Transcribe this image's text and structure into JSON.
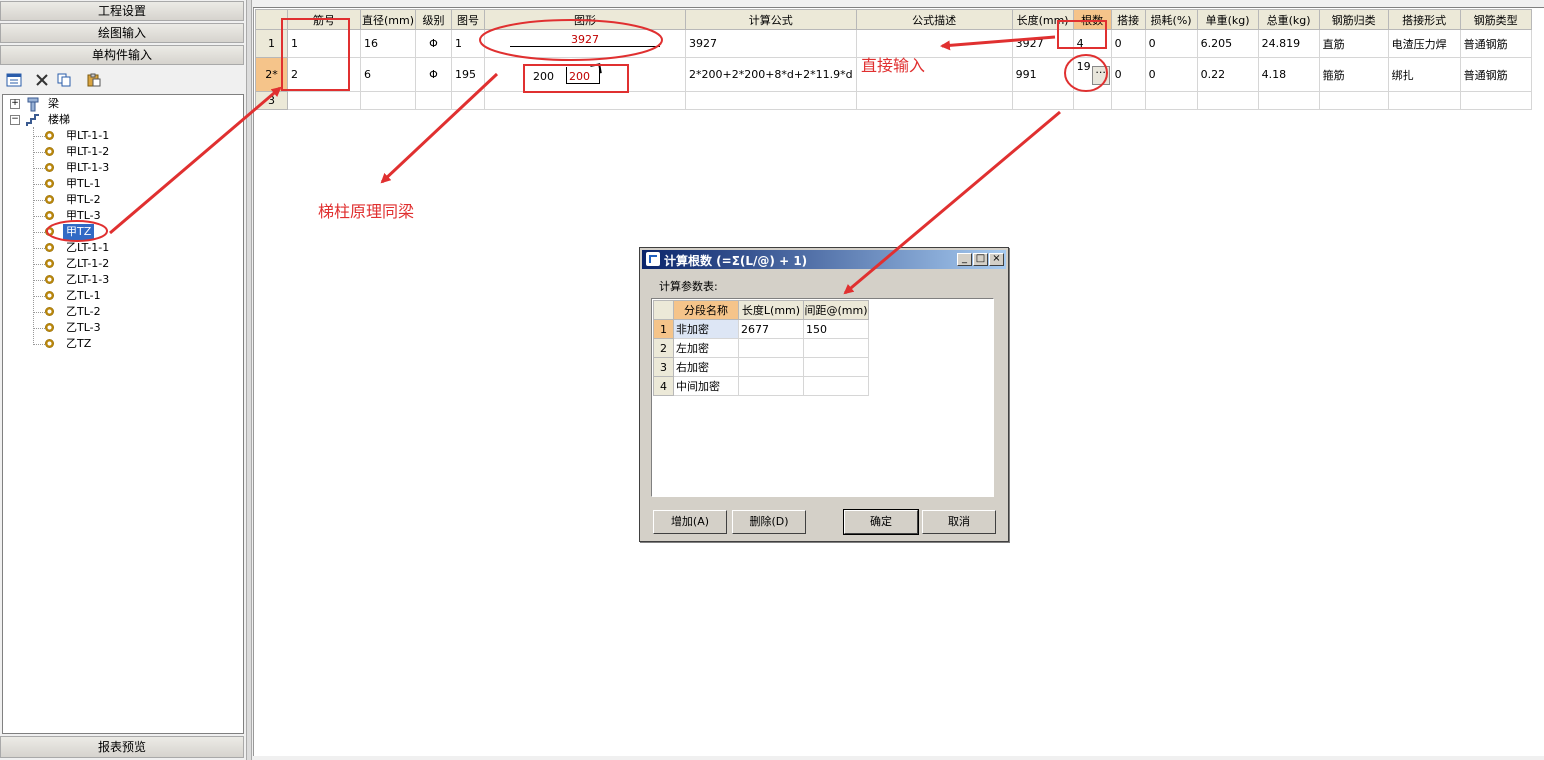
{
  "left_panel": {
    "nav": [
      "工程设置",
      "绘图输入",
      "单构件输入"
    ],
    "bottom_button": "报表预览",
    "tree": {
      "roots": [
        {
          "label": "梁",
          "expanded": false
        },
        {
          "label": "楼梯",
          "expanded": true
        }
      ],
      "children": [
        "甲LT-1-1",
        "甲LT-1-2",
        "甲LT-1-3",
        "甲TL-1",
        "甲TL-2",
        "甲TL-3",
        "甲TZ",
        "乙LT-1-1",
        "乙LT-1-2",
        "乙LT-1-3",
        "乙TL-1",
        "乙TL-2",
        "乙TL-3",
        "乙TZ"
      ],
      "selected": "甲TZ"
    }
  },
  "grid": {
    "headers": [
      "筋号",
      "直径(mm)",
      "级别",
      "图号",
      "图形",
      "计算公式",
      "公式描述",
      "长度(mm)",
      "根数",
      "搭接",
      "损耗(%)",
      "单重(kg)",
      "总重(kg)",
      "钢筋归类",
      "搭接形式",
      "钢筋类型"
    ],
    "highlighted_header": "根数",
    "rows": [
      {
        "rownum": "1",
        "jin_hao": "1",
        "diameter": "16",
        "grade": "Φ",
        "fig_no": "1",
        "shape_value": "3927",
        "formula": "3927",
        "desc": "",
        "length": "3927",
        "count": "4",
        "lap": "0",
        "loss": "0",
        "unit_weight": "6.205",
        "total_weight": "24.819",
        "category": "直筋",
        "lap_type": "电渣压力焊",
        "rebar_type": "普通钢筋"
      },
      {
        "rownum": "2*",
        "jin_hao": "2",
        "diameter": "6",
        "grade": "Φ",
        "fig_no": "195",
        "shape_a": "200",
        "shape_b": "200",
        "formula": "2*200+2*200+8*d+2*11.9*d",
        "desc": "",
        "length": "991",
        "count": "19",
        "lap": "0",
        "loss": "0",
        "unit_weight": "0.22",
        "total_weight": "4.18",
        "category": "箍筋",
        "lap_type": "绑扎",
        "rebar_type": "普通钢筋"
      },
      {
        "rownum": "3"
      }
    ]
  },
  "annotations": {
    "direct_input": "直接输入",
    "same_as_beam": "梯柱原理同梁",
    "color": "#e03030"
  },
  "dialog": {
    "title": "计算根数 (=Σ(L/@) + 1)",
    "label": "计算参数表:",
    "headers": [
      "分段名称",
      "长度L(mm)",
      "间距@(mm)"
    ],
    "rows": [
      {
        "num": "1",
        "name": "非加密",
        "length": "2677",
        "spacing": "150"
      },
      {
        "num": "2",
        "name": "左加密",
        "length": "",
        "spacing": ""
      },
      {
        "num": "3",
        "name": "右加密",
        "length": "",
        "spacing": ""
      },
      {
        "num": "4",
        "name": "中间加密",
        "length": "",
        "spacing": ""
      }
    ],
    "buttons": {
      "add": "增加(A)",
      "delete": "删除(D)",
      "ok": "确定",
      "cancel": "取消"
    }
  }
}
